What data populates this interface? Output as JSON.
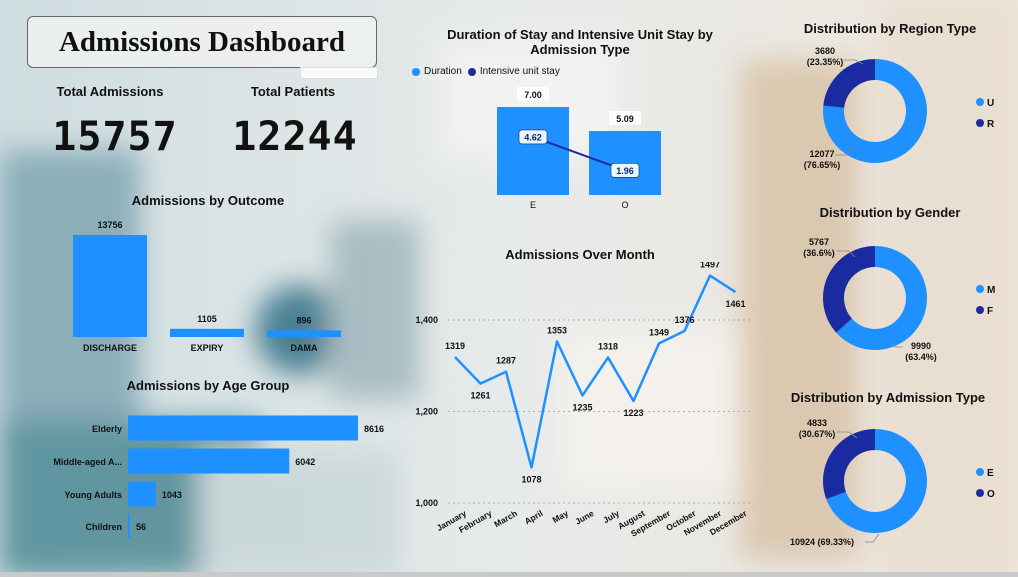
{
  "header": {
    "title": "Admissions Dashboard"
  },
  "kpis": [
    {
      "label": "Total Admissions",
      "value": "15757"
    },
    {
      "label": "Total Patients",
      "value": "12244"
    }
  ],
  "colors": {
    "primary": "#1e90ff",
    "dark": "#1a2aa0",
    "label_bg": "#eaf6ff"
  },
  "chart_data": [
    {
      "id": "outcome",
      "type": "bar",
      "title": "Admissions by Outcome",
      "categories": [
        "DISCHARGE",
        "EXPIRY",
        "DAMA"
      ],
      "values": [
        13756,
        1105,
        896
      ],
      "data_labels": [
        "13756",
        "1105",
        "896"
      ]
    },
    {
      "id": "age",
      "type": "bar",
      "orientation": "horizontal",
      "title": "Admissions by Age Group",
      "categories": [
        "Elderly",
        "Middle-aged A...",
        "Young Adults",
        "Children"
      ],
      "values": [
        8616,
        6042,
        1043,
        56
      ],
      "data_labels": [
        "8616",
        "6042",
        "1043",
        "56"
      ]
    },
    {
      "id": "duration",
      "type": "bar",
      "title": "Duration of Stay and Intensive Unit Stay by Admission Type",
      "categories": [
        "E",
        "O"
      ],
      "legend_position": "top-left",
      "series": [
        {
          "name": "Duration",
          "type": "bar",
          "values": [
            7.0,
            5.09
          ],
          "data_labels": [
            "7.00",
            "5.09"
          ]
        },
        {
          "name": "Intensive unit stay",
          "type": "line",
          "values": [
            4.62,
            1.96
          ],
          "data_labels": [
            "4.62",
            "1.96"
          ]
        }
      ]
    },
    {
      "id": "month",
      "type": "line",
      "title": "Admissions Over Month",
      "categories": [
        "January",
        "February",
        "March",
        "April",
        "May",
        "June",
        "July",
        "August",
        "September",
        "October",
        "November",
        "December"
      ],
      "values": [
        1319,
        1261,
        1287,
        1078,
        1353,
        1235,
        1318,
        1223,
        1349,
        1376,
        1497,
        1461
      ],
      "data_labels": [
        "1319",
        "1261",
        "1287",
        "1078",
        "1353",
        "1235",
        "1318",
        "1223",
        "1349",
        "1376",
        "1497",
        "1461"
      ],
      "ylim": [
        1000,
        1400
      ],
      "yticks": [
        "1,000",
        "1,200",
        "1,400"
      ],
      "grid": true
    },
    {
      "id": "region",
      "type": "pie",
      "donut": true,
      "title": "Distribution by Region Type",
      "legend_position": "right",
      "slices": [
        {
          "name": "U",
          "value": 12077,
          "label": "12077",
          "pct": "(76.65%)"
        },
        {
          "name": "R",
          "value": 3680,
          "label": "3680",
          "pct": "(23.35%)"
        }
      ]
    },
    {
      "id": "gender",
      "type": "pie",
      "donut": true,
      "title": "Distribution by Gender",
      "legend_position": "right",
      "slices": [
        {
          "name": "M",
          "value": 9990,
          "label": "9990",
          "pct": "(63.4%)"
        },
        {
          "name": "F",
          "value": 5767,
          "label": "5767",
          "pct": "(36.6%)"
        }
      ]
    },
    {
      "id": "admtype",
      "type": "pie",
      "donut": true,
      "title": "Distribution by Admission Type",
      "legend_position": "right",
      "slices": [
        {
          "name": "E",
          "value": 10924,
          "label": "10924 (69.33%)",
          "pct": ""
        },
        {
          "name": "O",
          "value": 4833,
          "label": "4833",
          "pct": "(30.67%)"
        }
      ]
    }
  ]
}
